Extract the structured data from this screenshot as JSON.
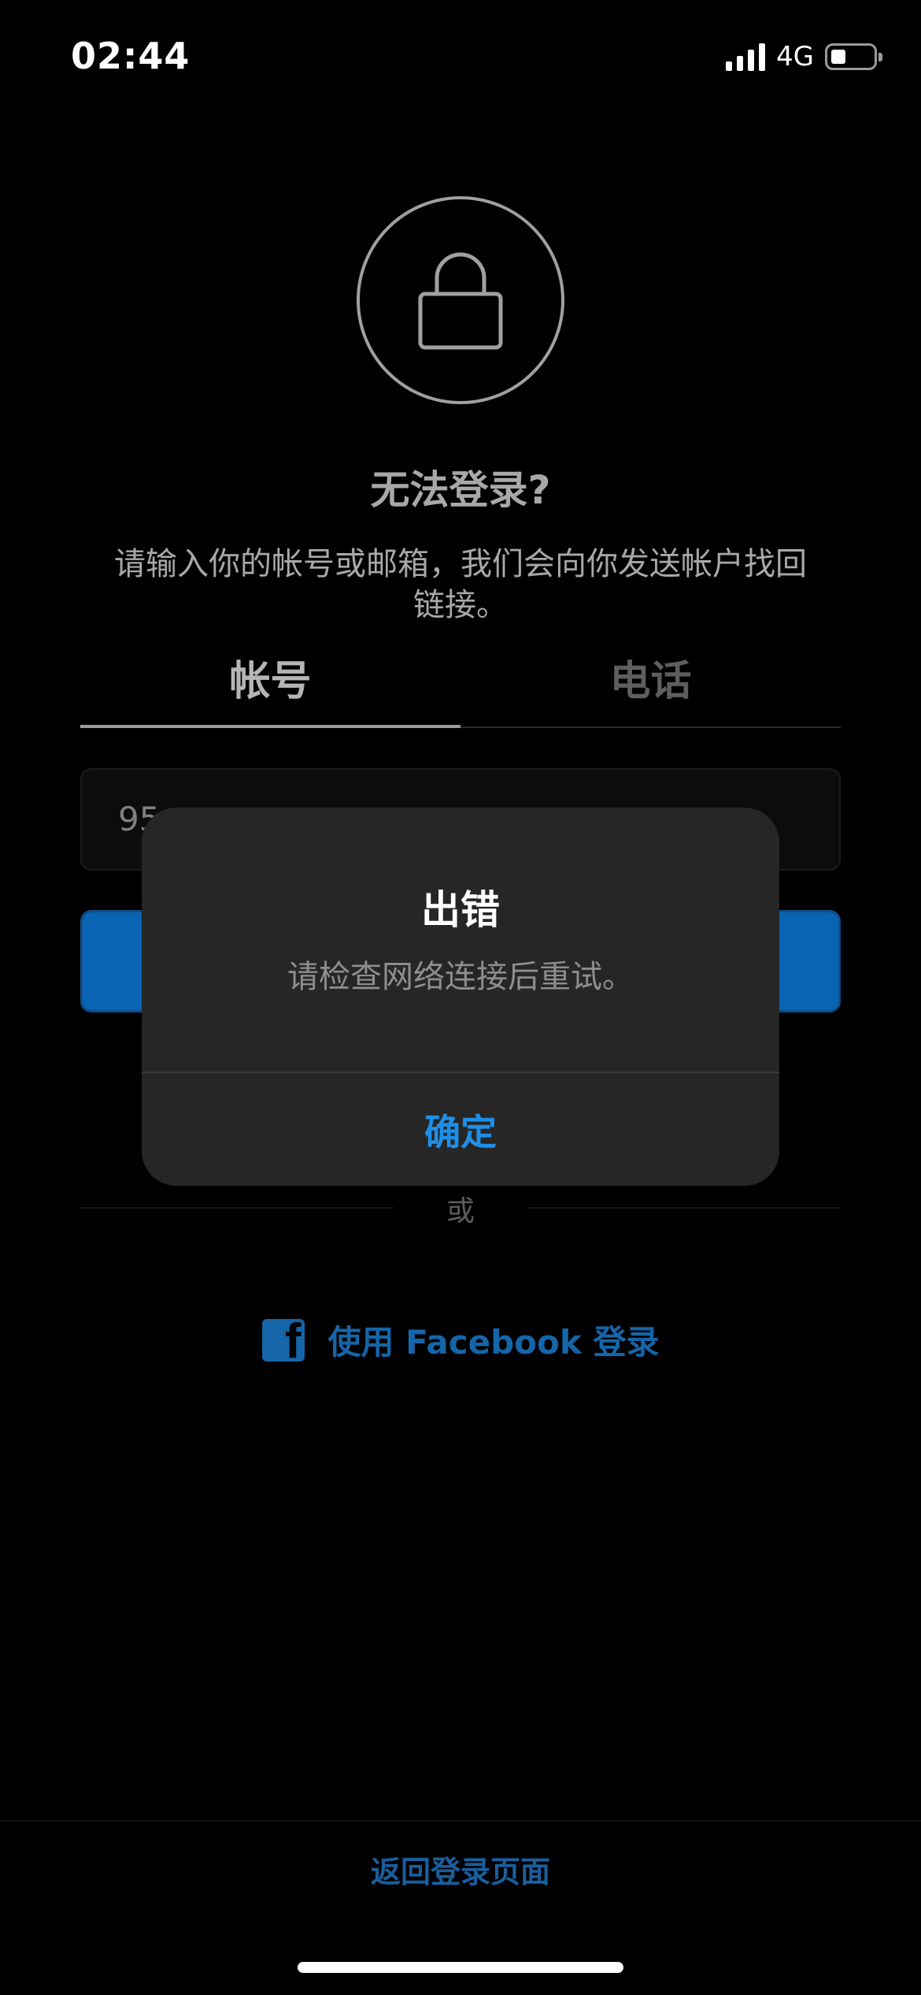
{
  "status_bar": {
    "time": "02:44",
    "network": "4G"
  },
  "recovery": {
    "title": "无法登录?",
    "description": "请输入你的帐号或邮箱，我们会向你发送帐户找回链接。",
    "tabs": [
      {
        "label": "帐号",
        "active": true
      },
      {
        "label": "电话",
        "active": false
      }
    ],
    "input_value": "95",
    "or_label": "或",
    "facebook_label": "使用 Facebook 登录",
    "back_link": "返回登录页面"
  },
  "alert": {
    "title": "出错",
    "message": "请检查网络连接后重试。",
    "ok_label": "确定"
  },
  "colors": {
    "accent": "#1e8fe8",
    "button_blue": "#0a64b4",
    "facebook_blue": "#1565a8"
  },
  "icons": {
    "lock": "lock-icon",
    "facebook": "facebook-icon"
  }
}
